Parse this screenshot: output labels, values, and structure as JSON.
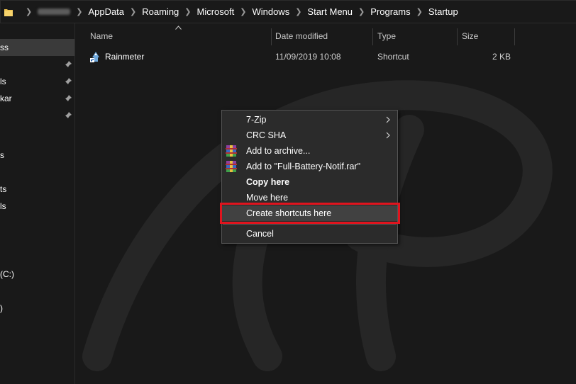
{
  "address_bar": {
    "crumbs": [
      "AppData",
      "Roaming",
      "Microsoft",
      "Windows",
      "Start Menu",
      "Programs",
      "Startup"
    ]
  },
  "nav_pane": {
    "items": [
      {
        "label": "ss",
        "selected": true,
        "pinned": false
      },
      {
        "label": "",
        "selected": false,
        "pinned": true
      },
      {
        "label": "ls",
        "selected": false,
        "pinned": true
      },
      {
        "label": "kar",
        "selected": false,
        "pinned": true
      },
      {
        "label": "",
        "selected": false,
        "pinned": true
      },
      {
        "label": "s",
        "selected": false,
        "pinned": false
      },
      {
        "label": "ts",
        "selected": false,
        "pinned": false
      },
      {
        "label": "ls",
        "selected": false,
        "pinned": false
      },
      {
        "label": "(C:)",
        "selected": false,
        "pinned": false
      },
      {
        "label": ")",
        "selected": false,
        "pinned": false
      }
    ]
  },
  "columns": {
    "name": "Name",
    "date_modified": "Date modified",
    "type": "Type",
    "size": "Size"
  },
  "files": [
    {
      "name": "Rainmeter",
      "date_modified": "11/09/2019 10:08",
      "type": "Shortcut",
      "size": "2 KB",
      "icon": "shortcut-icon"
    }
  ],
  "context_menu": {
    "items": [
      {
        "label": "7-Zip",
        "submenu": true,
        "icon": "",
        "bold": false
      },
      {
        "label": "CRC SHA",
        "submenu": true,
        "icon": "",
        "bold": false
      },
      {
        "label": "Add to archive...",
        "submenu": false,
        "icon": "winrar-icon",
        "bold": false
      },
      {
        "label": "Add to \"Full-Battery-Notif.rar\"",
        "submenu": false,
        "icon": "winrar-icon",
        "bold": false
      },
      {
        "label": "Copy here",
        "submenu": false,
        "icon": "",
        "bold": true
      },
      {
        "label": "Move here",
        "submenu": false,
        "icon": "",
        "bold": false
      },
      {
        "label": "Create shortcuts here",
        "submenu": false,
        "icon": "",
        "bold": false,
        "highlighted": true
      },
      {
        "label": "Cancel",
        "submenu": false,
        "icon": "",
        "bold": false
      }
    ]
  },
  "colors": {
    "background": "#191919",
    "menu_background": "#2b2b2b",
    "highlight_border": "#e0141e",
    "hover": "#414141"
  }
}
